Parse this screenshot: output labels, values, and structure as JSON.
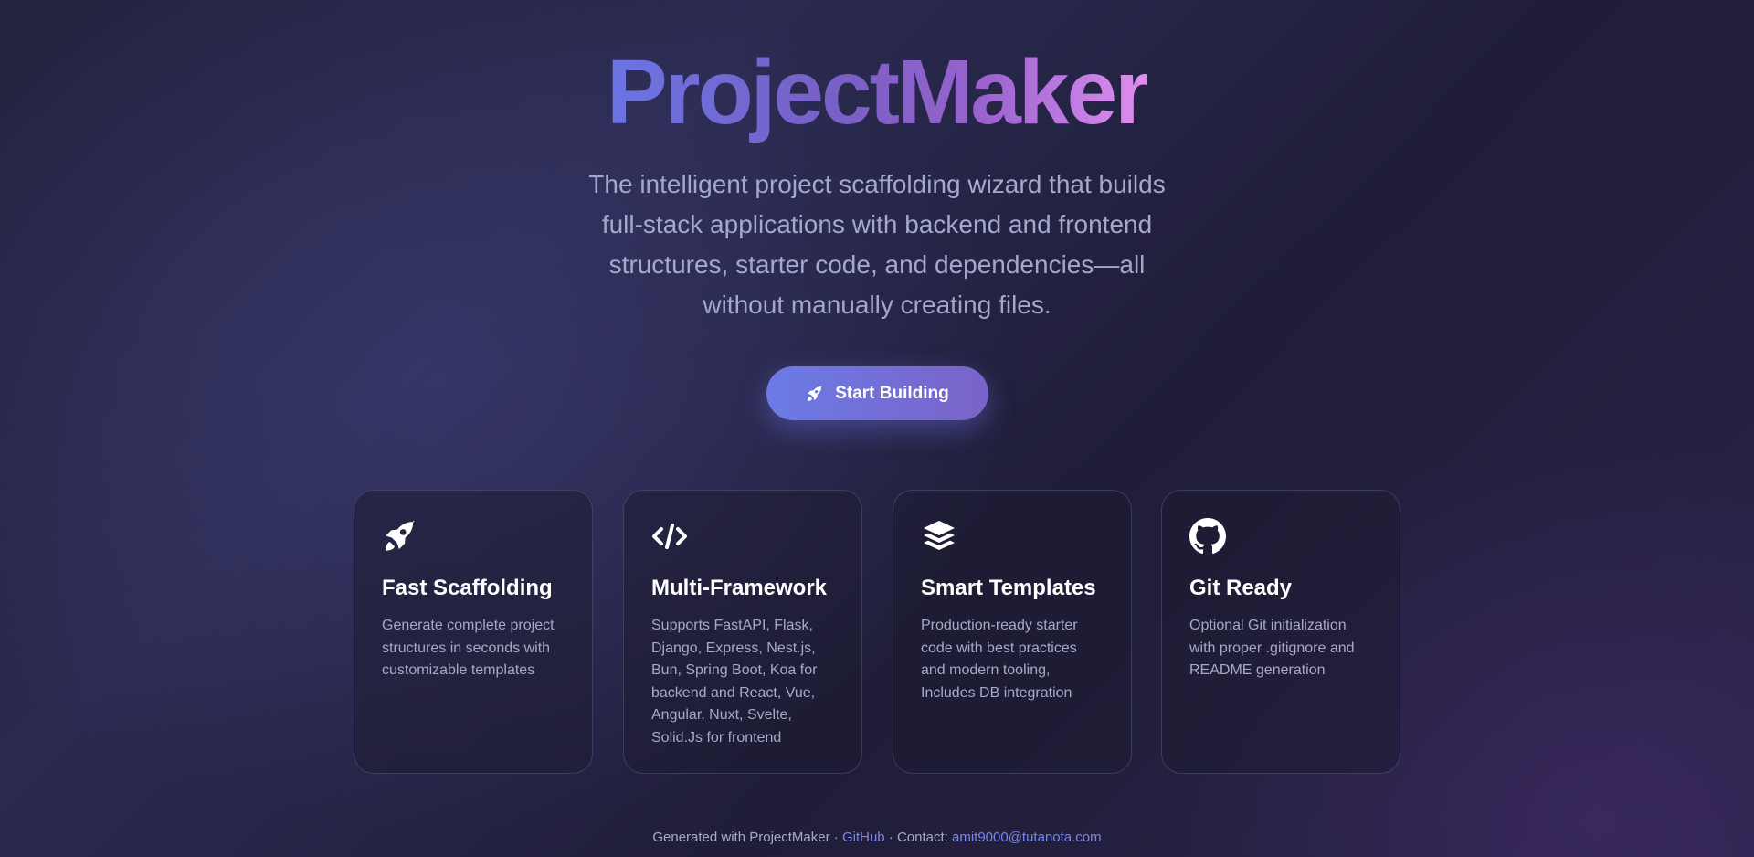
{
  "hero": {
    "title": "ProjectMaker",
    "tagline": "The intelligent project scaffolding wizard that builds full-stack applications with backend and frontend structures, starter code, and dependencies—all without manually creating files.",
    "cta": {
      "label": "Start Building",
      "icon": "rocket-icon"
    }
  },
  "features": [
    {
      "icon": "rocket-icon",
      "title": "Fast Scaffolding",
      "description": "Generate complete project structures in seconds with customizable templates"
    },
    {
      "icon": "code-icon",
      "title": "Multi-Framework",
      "description": "Supports FastAPI, Flask, Django, Express, Nest.js, Bun, Spring Boot, Koa for backend and React, Vue, Angular, Nuxt, Svelte, Solid.Js for frontend"
    },
    {
      "icon": "layers-icon",
      "title": "Smart Templates",
      "description": "Production-ready starter code with best practices and modern tooling, Includes DB integration"
    },
    {
      "icon": "github-icon",
      "title": "Git Ready",
      "description": "Optional Git initialization with proper .gitignore and README generation"
    }
  ],
  "footer": {
    "prefix": "Generated with ProjectMaker · ",
    "github_label": "GitHub",
    "contact_prefix": " · Contact: ",
    "email": "amit9000@tutanota.com"
  },
  "colors": {
    "accent_start": "#6c7be6",
    "accent_end": "#7a63c8",
    "link": "#7a86e8",
    "muted_text": "#a7aac7"
  }
}
